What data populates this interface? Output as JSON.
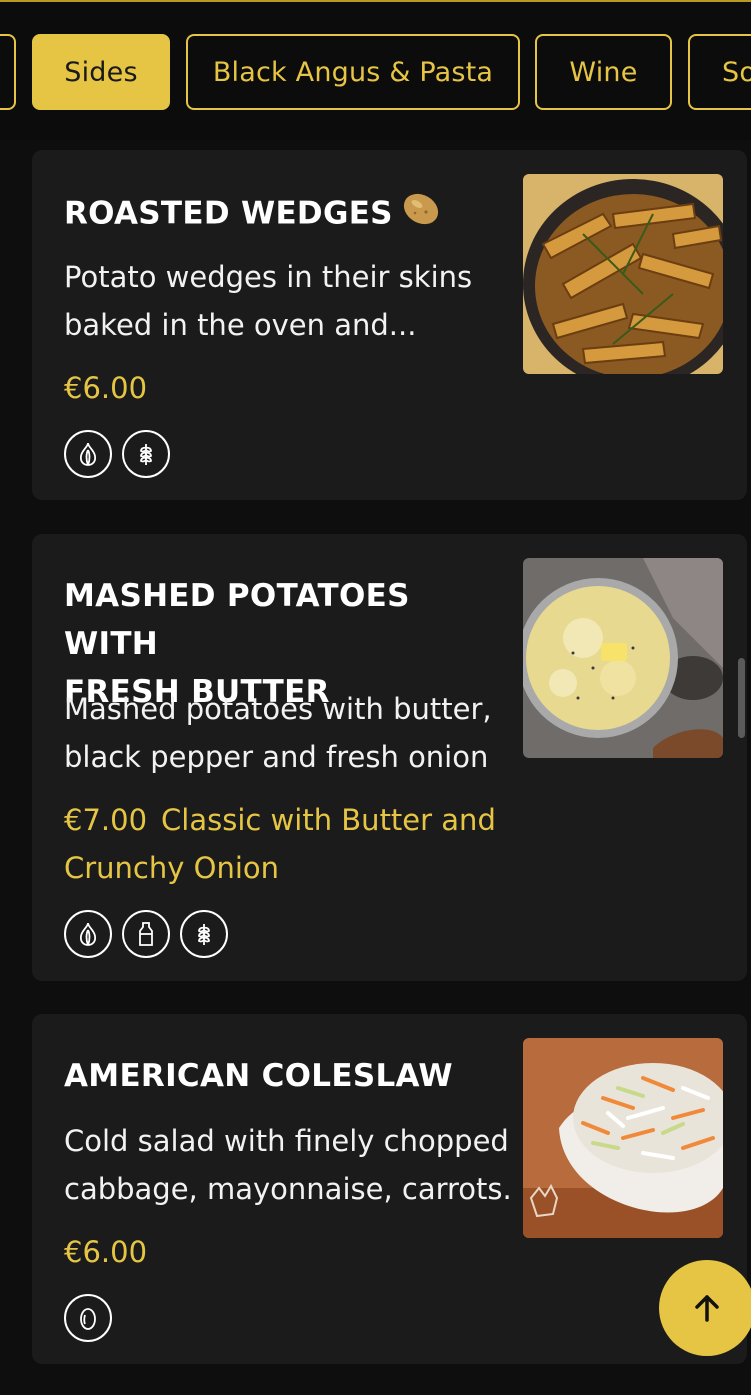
{
  "tabs": [
    {
      "label": ""
    },
    {
      "label": "Sides",
      "active": true
    },
    {
      "label": "Black Angus & Pasta"
    },
    {
      "label": "Wine"
    },
    {
      "label": "So"
    }
  ],
  "items": [
    {
      "title": "ROASTED WEDGES",
      "title_emoji": "potato-icon",
      "description_lines": [
        "Potato wedges in their skins",
        "baked in the oven and..."
      ],
      "price": "€6.00",
      "variant": "",
      "allergens": [
        "garlic-icon",
        "gluten-icon"
      ],
      "image": "roasted-wedges-photo"
    },
    {
      "title_lines": [
        "MASHED POTATOES WITH",
        "FRESH BUTTER"
      ],
      "description_lines": [
        "Mashed potatoes with butter,",
        "black pepper and fresh onion"
      ],
      "price": "€7.00",
      "variant_lines": [
        "Classic with Butter and",
        "Crunchy Onion"
      ],
      "allergens": [
        "garlic-icon",
        "milk-icon",
        "gluten-icon"
      ],
      "image": "mashed-potatoes-photo"
    },
    {
      "title": "AMERICAN COLESLAW",
      "description_lines": [
        "Cold salad with finely chopped",
        "cabbage, mayonnaise, carrots."
      ],
      "price": "€6.00",
      "variant": "",
      "allergens": [
        "egg-icon"
      ],
      "image": "coleslaw-photo"
    }
  ],
  "colors": {
    "accent": "#e6c544",
    "card": "#1b1b1b",
    "background": "#0e0e0e"
  },
  "scroll_top": {
    "icon": "arrow-up-icon"
  }
}
